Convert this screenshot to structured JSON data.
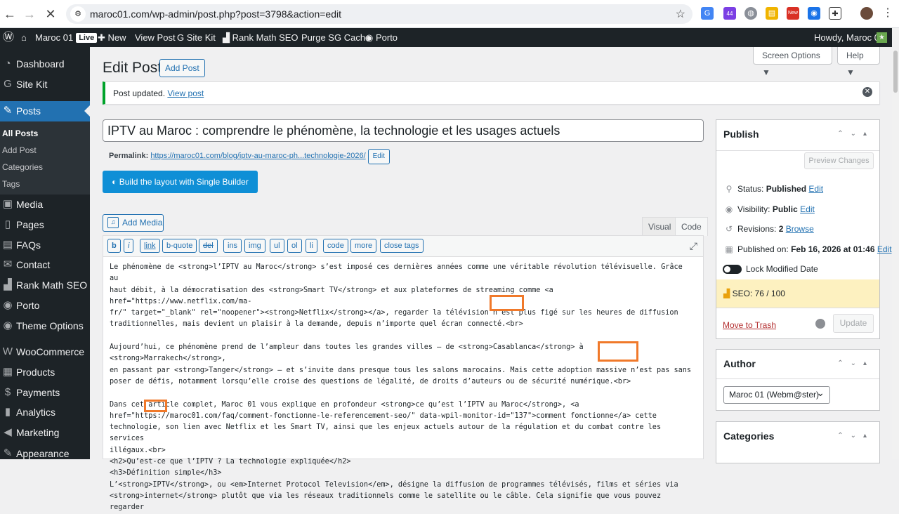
{
  "browser": {
    "url": "maroc01.com/wp-admin/post.php?post=3798&action=edit",
    "ext_badge": "44",
    "ext_new": "New"
  },
  "adminbar": {
    "site": "Maroc 01",
    "live": "Live",
    "new": "New",
    "view_post": "View Post",
    "site_kit": "Site Kit",
    "rank_math": "Rank Math SEO",
    "purge": "Purge SG Cache",
    "porto": "Porto",
    "howdy": "Howdy, Maroc 01"
  },
  "sidebar": {
    "items": [
      "Dashboard",
      "Site Kit",
      "Posts",
      "Media",
      "Pages",
      "FAQs",
      "Contact",
      "Rank Math SEO",
      "Porto",
      "Theme Options",
      "WooCommerce",
      "Products",
      "Payments",
      "Analytics",
      "Marketing",
      "Appearance"
    ],
    "sub": [
      "All Posts",
      "Add Post",
      "Categories",
      "Tags"
    ]
  },
  "header": {
    "screen_options": "Screen Options ▼",
    "help": "Help ▼",
    "title": "Edit Post",
    "add_post": "Add Post"
  },
  "notice": {
    "text": "Post updated.",
    "link": "View post"
  },
  "post": {
    "title": "IPTV au Maroc : comprendre le phénomène, la technologie et les usages actuels",
    "permalink_label": "Permalink:",
    "permalink_url": "https://maroc01.com/blog/iptv-au-maroc-ph...technologie-2026/",
    "edit": "Edit"
  },
  "builder": {
    "label": "Build the layout with Single Builder"
  },
  "editor": {
    "add_media": "Add Media",
    "tab_visual": "Visual",
    "tab_code": "Code",
    "quicktags": [
      "b",
      "i",
      "link",
      "b-quote",
      "del",
      "ins",
      "img",
      "ul",
      "ol",
      "li",
      "code",
      "more",
      "close tags"
    ],
    "content": "Le phénomène de <strong>l’IPTV au Maroc</strong> s’est imposé ces dernières années comme une véritable révolution télévisuelle. Grâce au\nhaut débit, à la démocratisation des <strong>Smart TV</strong> et aux plateformes de streaming comme <a href=\"https://www.netflix.com/ma-\nfr/\" target=\"_blank\" rel=\"noopener\"><strong>Netflix</strong></a>, regarder la télévision n’est plus figé sur les heures de diffusion\ntraditionnelles, mais devient un plaisir à la demande, depuis n’importe quel écran connecté.<br>\n\nAujourd’hui, ce phénomène prend de l’ampleur dans toutes les grandes villes — de <strong>Casablanca</strong> à <strong>Marrakech</strong>,\nen passant par <strong>Tanger</strong> — et s’invite dans presque tous les salons marocains. Mais cette adoption massive n’est pas sans\nposer de défis, notamment lorsqu’elle croise des questions de légalité, de droits d’auteurs ou de sécurité numérique.<br>\n\nDans cet article complet, Maroc 01 vous explique en profondeur <strong>ce qu’est l’IPTV au Maroc</strong>, <a\nhref=\"https://maroc01.com/faq/comment-fonctionne-le-referencement-seo/\" data-wpil-monitor-id=\"137\">comment fonctionne</a> cette\ntechnologie, son lien avec Netflix et les Smart TV, ainsi que les enjeux actuels autour de la régulation et du combat contre les services\nillégaux.<br>\n<h2>Qu’est-ce que l’IPTV ? La technologie expliquée</h2>\n<h3>Définition simple</h3>\nL’<strong>IPTV</strong>, ou <em>Internet Protocol Television</em>, désigne la diffusion de programmes télévisés, films et séries via\n<strong>internet</strong> plutôt que via les réseaux traditionnels comme le satellite ou le câble. Cela signifie que vous pouvez regarder"
  },
  "publish": {
    "title": "Publish",
    "preview": "Preview Changes",
    "status_label": "Status:",
    "status": "Published",
    "visibility_label": "Visibility:",
    "visibility": "Public",
    "revisions_label": "Revisions:",
    "revisions": "2",
    "browse": "Browse",
    "published_label": "Published on:",
    "published": "Feb 16, 2026 at 01:46",
    "edit": "Edit",
    "lock": "Lock Modified Date",
    "seo": "SEO: 76 / 100",
    "trash": "Move to Trash",
    "update": "Update"
  },
  "author": {
    "title": "Author",
    "selected": "Maroc 01 (Webm@ster)"
  },
  "categories": {
    "title": "Categories"
  },
  "colors": {
    "accent": "#2271b1",
    "adminbar": "#1d2327",
    "highlight": "#f0792a",
    "seo_bg": "#fdf1c0"
  }
}
